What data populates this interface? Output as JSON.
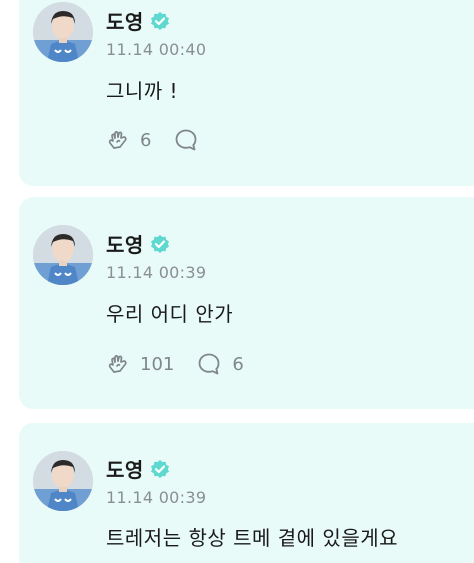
{
  "posts": [
    {
      "author": "도영",
      "timestamp": "11.14 00:40",
      "message": "그니까 !",
      "like_count": "6",
      "reply_count": ""
    },
    {
      "author": "도영",
      "timestamp": "11.14 00:39",
      "message": "우리 어디 안가",
      "like_count": "101",
      "reply_count": "6"
    },
    {
      "author": "도영",
      "timestamp": "11.14 00:39",
      "message": "트레저는 항상 트메 곁에 있을게요",
      "like_count": "",
      "reply_count": ""
    }
  ],
  "icons": {
    "verified": "verified-badge-icon",
    "like": "heart-hands-icon",
    "reply": "speech-bubble-icon"
  },
  "colors": {
    "card_background": "#e8fbf8",
    "verified_badge": "#5fd9cf",
    "text_primary": "#1a1a1a",
    "text_secondary": "#8a8f94",
    "icon_gray": "#7f868c"
  }
}
